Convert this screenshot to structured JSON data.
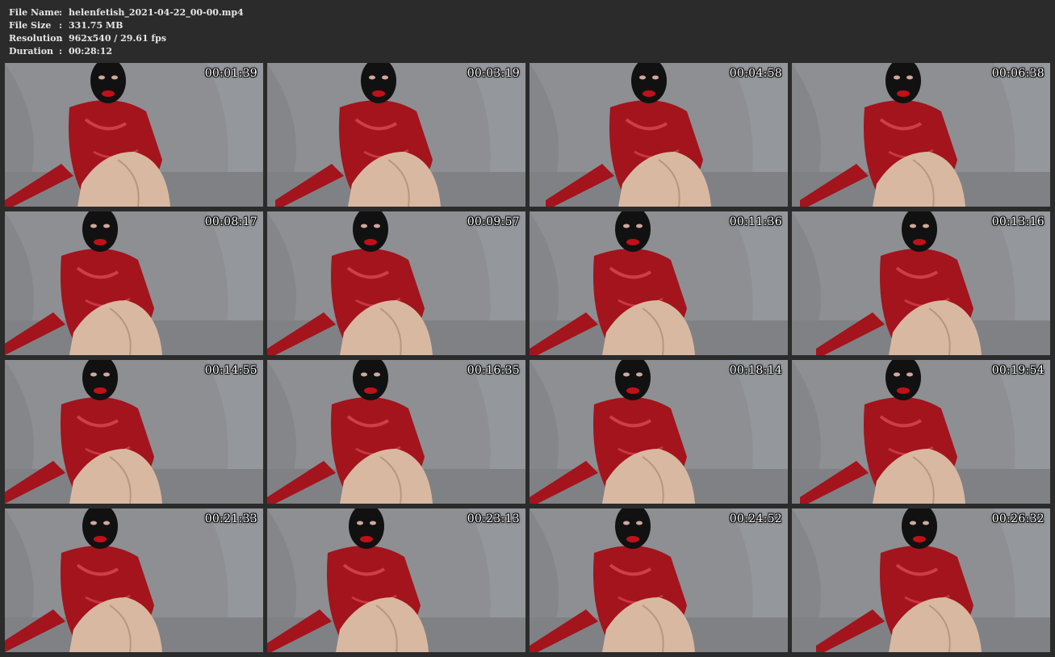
{
  "info": {
    "file_name_label": "File Name",
    "file_name_value": "helenfetish_2021-04-22_00-00.mp4",
    "file_size_label": "File Size",
    "file_size_value": "331.75 MB",
    "resolution_label": "Resolution",
    "resolution_value": "962x540 / 29.61 fps",
    "duration_label": "Duration",
    "duration_value": "00:28:12",
    "separator": ":"
  },
  "thumbnails": [
    {
      "timestamp": "00:01:39"
    },
    {
      "timestamp": "00:03:19"
    },
    {
      "timestamp": "00:04:58"
    },
    {
      "timestamp": "00:06:38"
    },
    {
      "timestamp": "00:08:17"
    },
    {
      "timestamp": "00:09:57"
    },
    {
      "timestamp": "00:11:36"
    },
    {
      "timestamp": "00:13:16"
    },
    {
      "timestamp": "00:14:55"
    },
    {
      "timestamp": "00:16:35"
    },
    {
      "timestamp": "00:18:14"
    },
    {
      "timestamp": "00:19:54"
    },
    {
      "timestamp": "00:21:33"
    },
    {
      "timestamp": "00:23:13"
    },
    {
      "timestamp": "00:24:52"
    },
    {
      "timestamp": "00:26:32"
    }
  ],
  "colors": {
    "page_background": "#2b2b2b",
    "backdrop": "#8d8f93",
    "garment": "#a3141c",
    "mask": "#111111",
    "skin": "#d9b8a2"
  }
}
